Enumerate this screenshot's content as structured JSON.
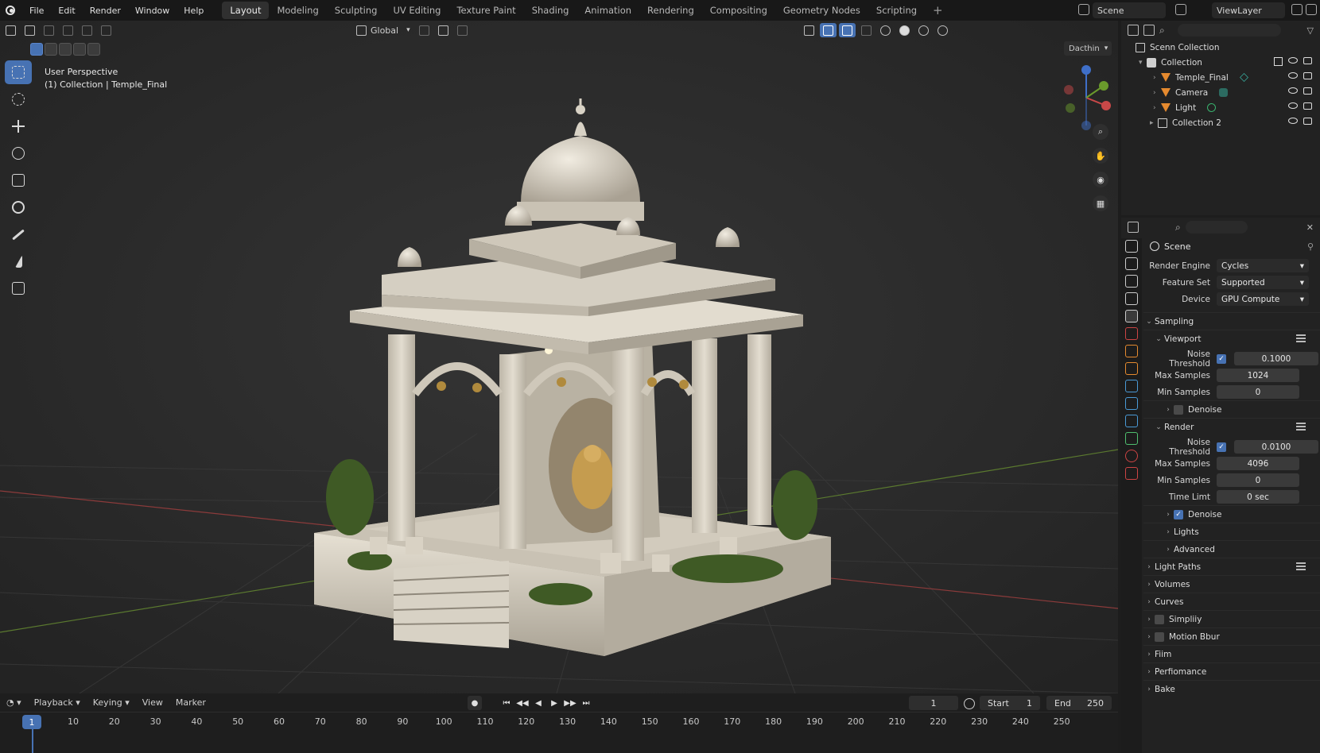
{
  "topbar": {
    "menu": [
      "File",
      "Edit",
      "Render",
      "Window",
      "Help"
    ],
    "workspaces": [
      "Layout",
      "Modeling",
      "Sculpting",
      "UV Editing",
      "Texture Paint",
      "Shading",
      "Animation",
      "Rendering",
      "Compositing",
      "Geometry Nodes",
      "Scripting"
    ],
    "active_workspace": "Layout",
    "scene": "Scene",
    "view_layer": "ViewLayer"
  },
  "viewport": {
    "transform_orientation": "Global",
    "perspective_label": "User Perspective",
    "collection_label": "(1) Collection | Temple_Final",
    "overlay_dropdown": "Dacthin",
    "tools": [
      "select-box",
      "cursor",
      "move",
      "rotate",
      "scale",
      "transform",
      "annotate",
      "measure",
      "add-cube"
    ]
  },
  "timeline": {
    "menus": [
      "Playback",
      "Keying",
      "View",
      "Marker"
    ],
    "current_frame": "1",
    "start_label": "Start",
    "start_value": "1",
    "end_label": "End",
    "end_value": "250",
    "ruler": [
      "1",
      "10",
      "20",
      "30",
      "40",
      "50",
      "60",
      "70",
      "80",
      "90",
      "100",
      "110",
      "120",
      "130",
      "140",
      "150",
      "160",
      "170",
      "180",
      "190",
      "200",
      "210",
      "220",
      "230",
      "240",
      "250"
    ]
  },
  "outliner": {
    "root": "Scenn Collection",
    "items": [
      {
        "label": "Collection",
        "type": "collection"
      },
      {
        "label": "Temple_Final",
        "type": "object"
      },
      {
        "label": "Camera",
        "type": "object"
      },
      {
        "label": "Light",
        "type": "object"
      },
      {
        "label": "Collection 2",
        "type": "collection"
      }
    ]
  },
  "properties": {
    "context": "Scene",
    "render_engine_label": "Render Engine",
    "render_engine": "Cycles",
    "feature_set_label": "Feature Set",
    "feature_set": "Supported",
    "device_label": "Device",
    "device": "GPU Compute",
    "sampling": "Sampling",
    "viewport": {
      "title": "Viewport",
      "noise_threshold_label": "Noise Threshold",
      "noise_threshold": "0.1000",
      "max_samples_label": "Max Samples",
      "max_samples": "1024",
      "min_samples_label": "Min Samples",
      "min_samples": "0",
      "denoise": "Denoise"
    },
    "render": {
      "title": "Render",
      "noise_threshold_label": "Noise Threshold",
      "noise_threshold": "0.0100",
      "max_samples_label": "Max Samples",
      "max_samples": "4096",
      "min_samples_label": "Min Samples",
      "min_samples": "0",
      "time_limit_label": "Time Limt",
      "time_limit": "0 sec",
      "denoise": "Denoise"
    },
    "sub_sections": [
      "Lights",
      "Advanced"
    ],
    "sections": [
      "Light Paths",
      "Volumes",
      "Curves",
      "Simpliiy",
      "Motion Bbur",
      "Fiim",
      "Perfiomance",
      "Bake"
    ]
  },
  "colors": {
    "accent": "#4772b3",
    "object_icon": "#e58a2f",
    "marble": "#d9d3c6"
  }
}
